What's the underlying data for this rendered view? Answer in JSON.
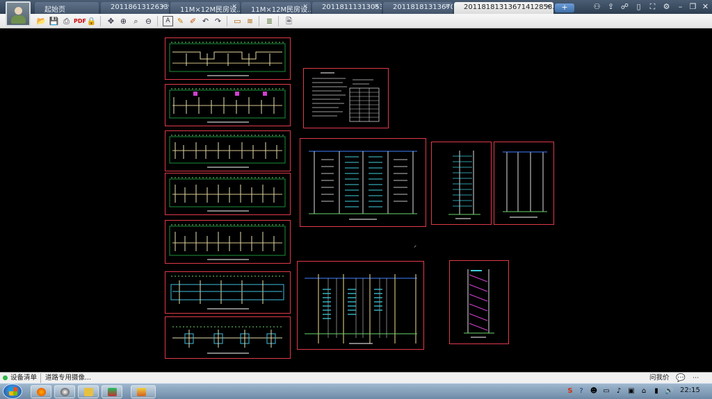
{
  "tabs": [
    {
      "label": "起始页",
      "active": false
    },
    {
      "label": "20118613126339...",
      "active": false
    },
    {
      "label": "11M×12M民房设...",
      "active": false
    },
    {
      "label": "11M×12M民房设...",
      "active": false
    },
    {
      "label": "20118111313053...",
      "active": false
    },
    {
      "label": "20118181313670...",
      "active": false
    },
    {
      "label": "20118181313671412858.d...",
      "active": true
    }
  ],
  "newtab_label": "+",
  "titlebar_icons": [
    "users-icon",
    "share-icon",
    "feedback-icon",
    "mobile-icon",
    "fullscreen-icon",
    "settings-icon",
    "minimize-icon",
    "restore-icon",
    "close-icon"
  ],
  "toolbar_icons": [
    "open-icon",
    "save-icon",
    "print-icon",
    "pdf-icon",
    "lock-icon",
    "pan-icon",
    "zoom-in-icon",
    "zoom-window-icon",
    "zoom-out-icon",
    "text-icon",
    "pencil-icon",
    "highlighter-icon",
    "undo-icon",
    "redo-icon",
    "measure-icon",
    "dimension-icon",
    "layers-icon",
    "export-icon"
  ],
  "status": {
    "item1": "设备清单",
    "item2": "道路专用摄像...",
    "ask": "问我价",
    "ask_icon": "chat-icon"
  },
  "taskbar": {
    "clock": "22:15",
    "apps": [
      "firefox-icon",
      "qq-icon",
      "folder-icon",
      "app-icon",
      "viewer-icon"
    ]
  }
}
